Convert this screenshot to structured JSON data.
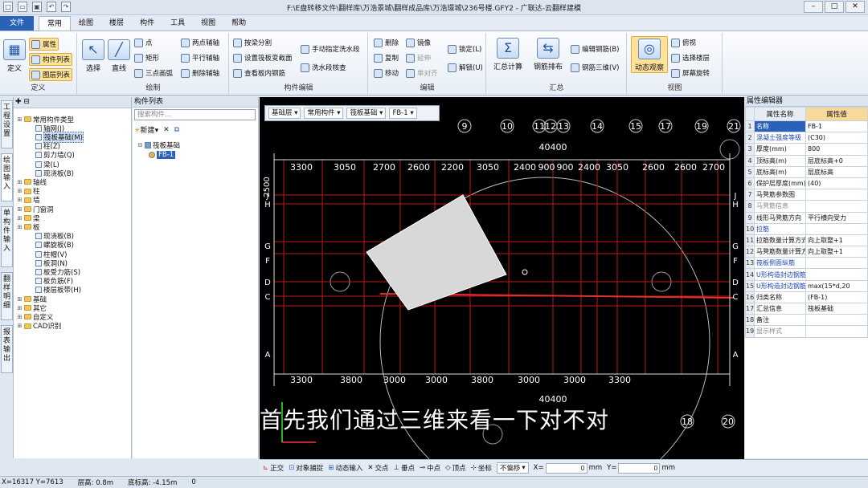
{
  "window": {
    "title": "F:\\E盘转移文件\\翻样库\\万浩景城\\翻样成品库\\万浩璟城\\236号楼.GFY2 - 广联达-云翻样建模"
  },
  "menu": {
    "file": "文件",
    "tabs": [
      "常用",
      "绘图",
      "楼层",
      "构件",
      "工具",
      "视图",
      "帮助"
    ]
  },
  "ribbon": {
    "groups": {
      "define": "定义",
      "draw": "绘制",
      "comp_edit": "构件编辑",
      "edit": "编辑",
      "summary": "汇总",
      "view": "视图"
    },
    "define_btn": "定义",
    "property": "属性",
    "comp_list": "构件列表",
    "layer_list": "图层列表",
    "select": "选择",
    "line": "直线",
    "point": "点",
    "rect": "矩形",
    "arc3": "三点画弧",
    "two_point_axis": "两点辅轴",
    "parallel_axis": "平行辅轴",
    "delete_axis": "删除辅轴",
    "split_board": "按梁分割",
    "set_slope": "设置筏板变截面",
    "view_rebar": "查看板内钢筋",
    "manual_water": "手动指定洗水段",
    "water_check": "洗水段核查",
    "del": "删除",
    "copy": "复制",
    "move": "移动",
    "mirror": "镜像",
    "extend": "延伸",
    "align": "单对齐",
    "lock": "锁定(L)",
    "unlock": "解锁(U)",
    "summary_calc": "汇总计算",
    "rebar_layout": "钢筋排布",
    "edit_rebar": "编辑钢筋(B)",
    "rebar_3d": "钢筋三维(V)",
    "dynamic_view": "动态观察",
    "view_op": "俯视",
    "select_layer": "选择楼层",
    "screen_rotate": "屏幕旋转"
  },
  "left_tabs": [
    "工程设置",
    "绘图输入",
    "单构件输入",
    "翻样明细",
    "报表输出"
  ],
  "tree": {
    "header": "",
    "items": [
      {
        "label": "常用构件类型",
        "level": 1,
        "folder": true
      },
      {
        "label": "轴网(J)",
        "level": 2,
        "folder": false
      },
      {
        "label": "筏板基础(M)",
        "level": 2,
        "folder": false,
        "selected": true
      },
      {
        "label": "柱(Z)",
        "level": 2,
        "folder": false
      },
      {
        "label": "剪力墙(Q)",
        "level": 2,
        "folder": false
      },
      {
        "label": "梁(L)",
        "level": 2,
        "folder": false
      },
      {
        "label": "现浇板(B)",
        "level": 2,
        "folder": false
      },
      {
        "label": "轴线",
        "level": 1,
        "folder": true
      },
      {
        "label": "柱",
        "level": 1,
        "folder": true
      },
      {
        "label": "墙",
        "level": 1,
        "folder": true
      },
      {
        "label": "门窗洞",
        "level": 1,
        "folder": true
      },
      {
        "label": "梁",
        "level": 1,
        "folder": true
      },
      {
        "label": "板",
        "level": 1,
        "folder": true
      },
      {
        "label": "现浇板(B)",
        "level": 2,
        "folder": false
      },
      {
        "label": "螺旋板(B)",
        "level": 2,
        "folder": false
      },
      {
        "label": "柱帽(V)",
        "level": 2,
        "folder": false
      },
      {
        "label": "板洞(N)",
        "level": 2,
        "folder": false
      },
      {
        "label": "板受力筋(S)",
        "level": 2,
        "folder": false
      },
      {
        "label": "板负筋(F)",
        "level": 2,
        "folder": false
      },
      {
        "label": "楼层板带(H)",
        "level": 2,
        "folder": false
      },
      {
        "label": "基础",
        "level": 1,
        "folder": true
      },
      {
        "label": "其它",
        "level": 1,
        "folder": true
      },
      {
        "label": "自定义",
        "level": 1,
        "folder": true
      },
      {
        "label": "CAD识别",
        "level": 1,
        "folder": true
      }
    ]
  },
  "complist": {
    "header": "构件列表",
    "search_placeholder": "搜索构件...",
    "new_btn": "新建",
    "group": "筏板基础",
    "item": "FB-1"
  },
  "canvas_toolbar": {
    "floor": "基础层",
    "type": "常用构件",
    "comp": "筏板基础",
    "name": "FB-1"
  },
  "canvas": {
    "top_axis_labels": [
      "9",
      "10",
      "11",
      "12",
      "13",
      "14",
      "15",
      "17",
      "19",
      "21"
    ],
    "top_total": "40400",
    "top_dims": [
      "3300",
      "3050",
      "2700",
      "2600",
      "2200",
      "3050",
      "2400",
      "900",
      "900",
      "2400",
      "3050",
      "2600",
      "2600",
      "2700"
    ],
    "left_dim": "2500",
    "row_labels": [
      "J",
      "H",
      "G",
      "F",
      "D",
      "C",
      "A"
    ],
    "bottom_dims": [
      "3300",
      "3800",
      "3000",
      "3000",
      "3800",
      "3000",
      "3000",
      "3300"
    ],
    "bottom_total": "40400",
    "bottom_axis_labels": [
      "18",
      "20"
    ],
    "subtitle": "首先我们通过三维来看一下对不对"
  },
  "props": {
    "header": "属性编辑器",
    "col_name": "属性名称",
    "col_value": "属性值",
    "rows": [
      {
        "n": "1",
        "k": "名称",
        "v": "FB-1",
        "blue": true,
        "sel": true
      },
      {
        "n": "2",
        "k": "混凝土强度等级",
        "v": "(C30)",
        "blue": true
      },
      {
        "n": "3",
        "k": "厚度(mm)",
        "v": "800"
      },
      {
        "n": "4",
        "k": "顶标高(m)",
        "v": "层底标高+0"
      },
      {
        "n": "5",
        "k": "底标高(m)",
        "v": "层底标高"
      },
      {
        "n": "6",
        "k": "保护层厚度(mm)",
        "v": "(40)"
      },
      {
        "n": "7",
        "k": "马凳筋参数图",
        "v": ""
      },
      {
        "n": "8",
        "k": "马凳筋信息",
        "v": "",
        "grey": true
      },
      {
        "n": "9",
        "k": "线形马凳筋方向",
        "v": "平行横向受力"
      },
      {
        "n": "10",
        "k": "拉筋",
        "v": "",
        "blue": true
      },
      {
        "n": "11",
        "k": "拉筋数量计算方式",
        "v": "向上取整+1"
      },
      {
        "n": "12",
        "k": "马凳筋数量计算方",
        "v": "向上取整+1"
      },
      {
        "n": "13",
        "k": "筏板侧面纵筋",
        "v": "",
        "blue": true
      },
      {
        "n": "14",
        "k": "U形构造封边钢筋",
        "v": "",
        "blue": true
      },
      {
        "n": "15",
        "k": "U形构造封边钢筋",
        "v": "max(15*d,20",
        "blue": true
      },
      {
        "n": "16",
        "k": "归类名称",
        "v": "(FB-1)"
      },
      {
        "n": "17",
        "k": "汇总信息",
        "v": "筏板基础"
      },
      {
        "n": "18",
        "k": "备注",
        "v": ""
      },
      {
        "n": "19",
        "k": "显示样式",
        "v": "",
        "grey": true
      }
    ]
  },
  "snapbar": {
    "ortho": "正交",
    "obj_snap": "对象捕捉",
    "dyn_input": "动态输入",
    "intersect": "交点",
    "perp": "垂点",
    "mid": "中点",
    "vertex": "顶点",
    "coord": "坐标",
    "no_offset": "不偏移",
    "x_label": "X=",
    "x_val": "0",
    "mm1": "mm",
    "y_label": "Y=",
    "y_val": "0",
    "mm2": "mm"
  },
  "status": {
    "coords": "X=16317 Y=7613",
    "floor_height": "层高: 0.8m",
    "bottom_elev": "底标高: -4.15m",
    "zero": "0"
  }
}
